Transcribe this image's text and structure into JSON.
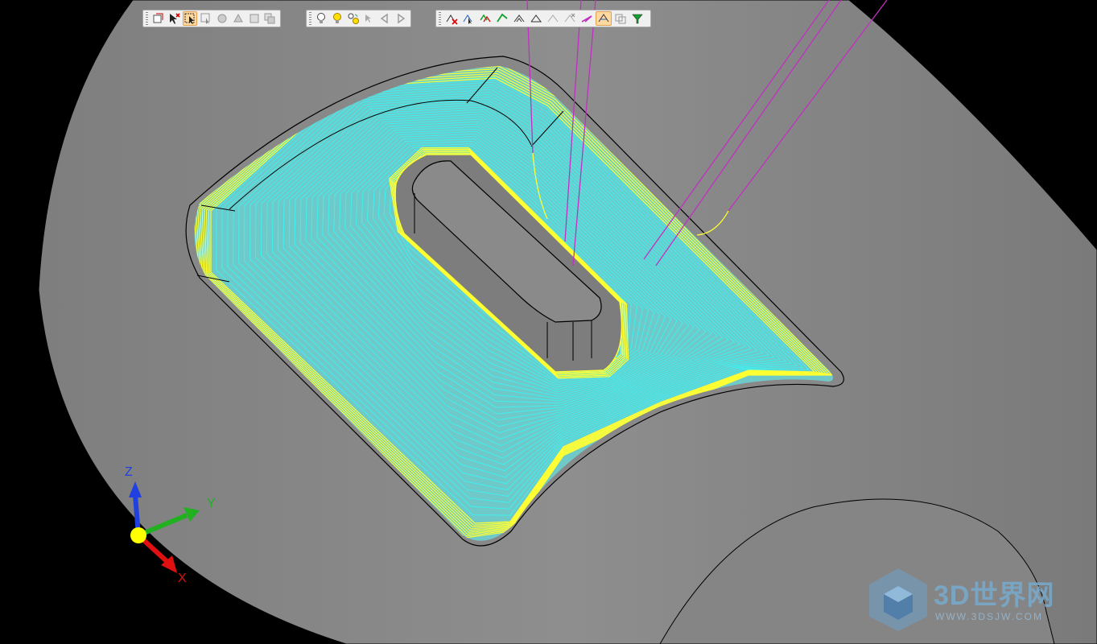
{
  "colors": {
    "background": "#000000",
    "part": "#8a8a8a",
    "toolpath_finish": "#ffff33",
    "toolpath_area": "#33e6e6",
    "link_moves": "#cc33cc",
    "axis_x": "#e01010",
    "axis_y": "#20b020",
    "axis_z": "#2040e0",
    "origin": "#ffff00"
  },
  "toolbars": [
    {
      "name": "selection-toolbar",
      "buttons": [
        {
          "name": "select-box-icon"
        },
        {
          "name": "deselect-icon"
        },
        {
          "name": "select-drag-icon",
          "active": true
        },
        {
          "name": "select-lasso-icon"
        },
        {
          "name": "select-surface-icon"
        },
        {
          "name": "select-faces-icon"
        },
        {
          "name": "select-hidden-icon"
        },
        {
          "name": "select-all-icon"
        }
      ]
    },
    {
      "name": "lighting-toolbar",
      "buttons": [
        {
          "name": "light-off-icon"
        },
        {
          "name": "light-on-icon"
        },
        {
          "name": "light-cycle-icon"
        },
        {
          "name": "pointer-disabled-icon"
        },
        {
          "name": "arrow-back-icon"
        },
        {
          "name": "arrow-forward-icon"
        }
      ]
    },
    {
      "name": "toolpath-toolbar",
      "buttons": [
        {
          "name": "toolpath-delete-icon"
        },
        {
          "name": "toolpath-select-icon"
        },
        {
          "name": "toolpath-group-icon"
        },
        {
          "name": "toolpath-green-icon"
        },
        {
          "name": "toolpath-link-icon"
        },
        {
          "name": "toolpath-lead-icon"
        },
        {
          "name": "toolpath-disabled-icon"
        },
        {
          "name": "toolpath-cross-icon"
        },
        {
          "name": "toolpath-magenta-icon"
        },
        {
          "name": "toolpath-active-icon",
          "active": true
        },
        {
          "name": "toolpath-copy-icon"
        },
        {
          "name": "toolpath-filter-icon"
        }
      ]
    }
  ],
  "axes": {
    "x_label": "X",
    "y_label": "Y",
    "z_label": "Z"
  },
  "watermark": {
    "brand": "3D世界网",
    "url": "WWW.3DSJW.COM"
  }
}
